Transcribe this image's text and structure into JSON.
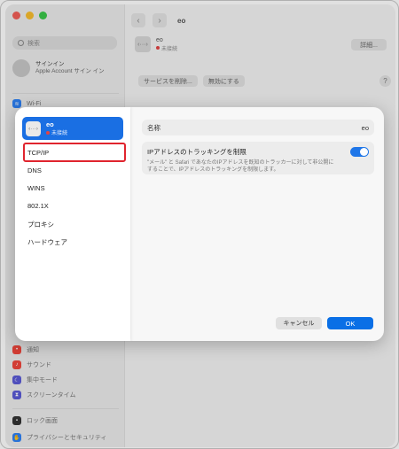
{
  "window": {
    "traffic_lights": [
      "#f25f58",
      "#f9bd2e",
      "#3bc84a"
    ]
  },
  "sidebar": {
    "search_placeholder": "検索",
    "account": {
      "title": "サインイン",
      "subtitle": "Apple Account サイン イン"
    },
    "items": [
      {
        "label": "Wi-Fi",
        "icon": "wifi-icon",
        "color": "#2e82f6"
      },
      {
        "label": "通知",
        "icon": "bell-icon",
        "color": "#f0463c"
      },
      {
        "label": "サウンド",
        "icon": "speaker-icon",
        "color": "#f0463c"
      },
      {
        "label": "集中モード",
        "icon": "moon-icon",
        "color": "#5b5bd6"
      },
      {
        "label": "スクリーンタイム",
        "icon": "hourglass-icon",
        "color": "#5b5bd6"
      },
      {
        "label": "ロック画面",
        "icon": "lock-icon",
        "color": "#333333"
      },
      {
        "label": "プライバシーとセキュリティ",
        "icon": "hand-icon",
        "color": "#2e82f6"
      }
    ]
  },
  "header": {
    "title": "eo",
    "service_name": "eo",
    "service_status": "未接続",
    "details_button": "詳細...",
    "remove_service_button": "サービスを削除...",
    "disable_button": "無効にする",
    "help_button": "?"
  },
  "dialog": {
    "service": {
      "name": "eo",
      "status": "未接続",
      "icon_text": "‹···›"
    },
    "tabs": [
      "TCP/IP",
      "DNS",
      "WINS",
      "802.1X",
      "プロキシ",
      "ハードウェア"
    ],
    "selected_tab": "TCP/IP",
    "name_label": "名称",
    "name_value": "eo",
    "tracking_title": "IPアドレスのトラッキングを制限",
    "tracking_description": "\"メール\" と Safari であなたのIPアドレスを既知のトラッカーに対して非公開にすることで、IPアドレスのトラッキングを制限します。",
    "tracking_enabled": true,
    "cancel_button": "キャンセル",
    "ok_button": "OK",
    "accent_color": "#1a6fe3"
  }
}
